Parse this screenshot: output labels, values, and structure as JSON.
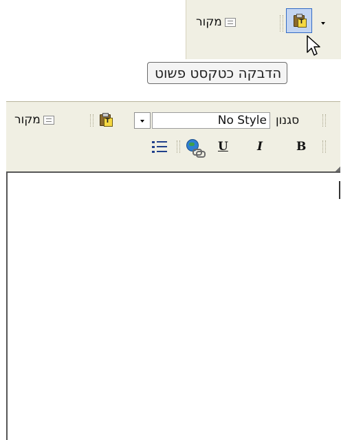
{
  "zoom": {
    "source_label": "מקור",
    "tooltip": "הדבקה כטקסט פשוט"
  },
  "toolbar": {
    "source_label": "מקור",
    "style_value": "No Style",
    "style_label": "סגנון",
    "underline_label": "U",
    "italic_label": "I",
    "bold_label": "B"
  },
  "icons": [
    "source-icon",
    "paste-plain-text-icon",
    "dropdown-arrow-icon",
    "mouse-pointer-icon",
    "bullet-list-icon",
    "link-icon",
    "underline-icon",
    "italic-icon",
    "bold-icon"
  ]
}
